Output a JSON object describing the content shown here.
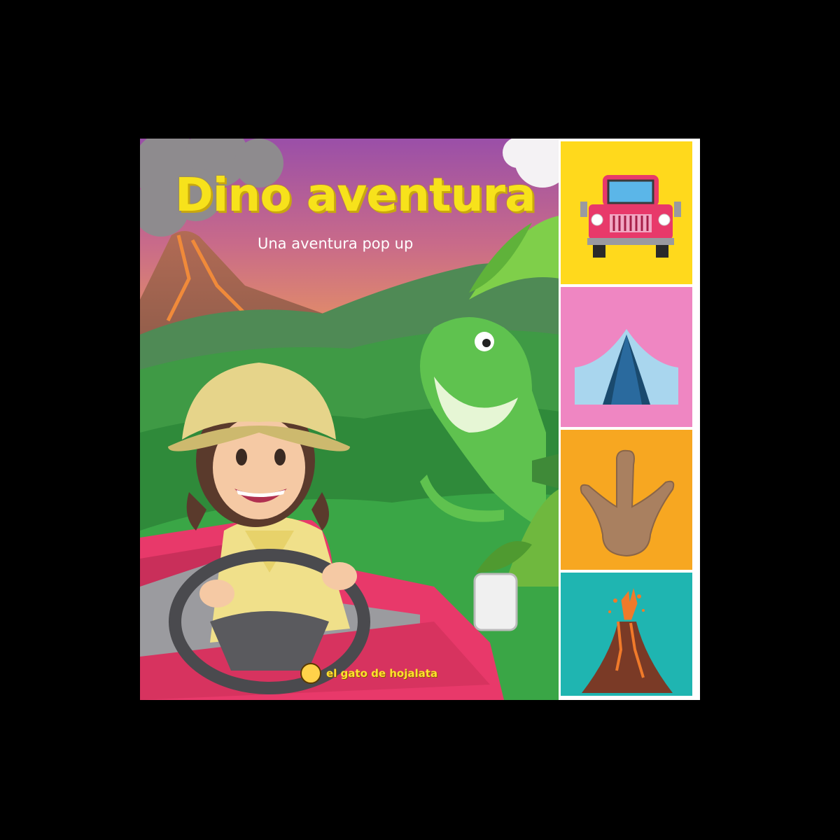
{
  "cover": {
    "title": "Dino aventura",
    "subtitle": "Una aventura pop up",
    "publisher": "el gato de hojalata",
    "colors": {
      "title": "#f7e21b",
      "jeep": "#e8396a",
      "sky_top": "#9a4fa8",
      "sky_bottom": "#f0a055",
      "jungle": "#3f9a45",
      "dinosaur": "#5fc24f"
    }
  },
  "tabs": [
    {
      "icon": "jeep-icon",
      "color": "#ffd91c"
    },
    {
      "icon": "tent-icon",
      "color": "#ef86c2"
    },
    {
      "icon": "dinosaur-footprint-icon",
      "color": "#f7a721"
    },
    {
      "icon": "volcano-icon",
      "color": "#1fb5b1"
    }
  ]
}
